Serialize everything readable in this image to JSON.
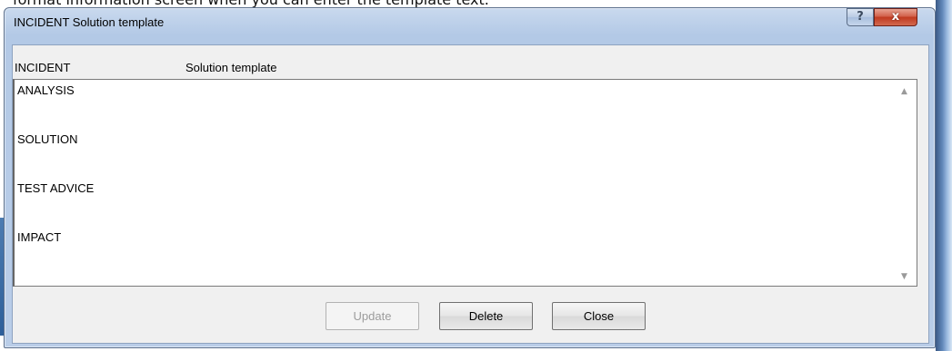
{
  "caption": "format information screen when you can enter the template text.",
  "window": {
    "title": "INCIDENT Solution template",
    "help_label": "?",
    "close_label": "x"
  },
  "form": {
    "type_label": "INCIDENT",
    "template_label": "Solution template",
    "lines": [
      "ANALYSIS",
      "SOLUTION",
      "TEST ADVICE",
      "IMPACT"
    ]
  },
  "buttons": {
    "update": "Update",
    "delete": "Delete",
    "close": "Close"
  }
}
